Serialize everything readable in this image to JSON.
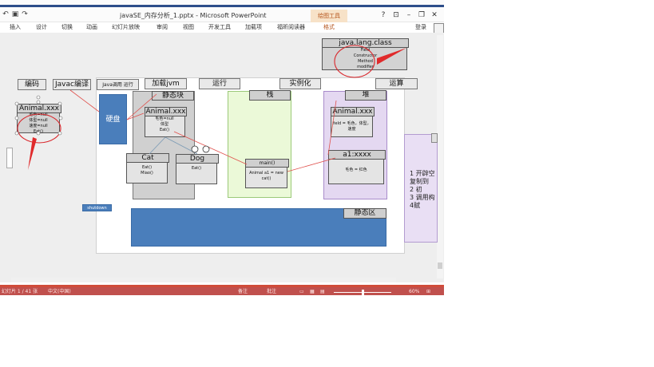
{
  "window": {
    "title": "javaSE_内存分析_1.pptx - Microsoft PowerPoint",
    "contextual_tab": "绘图工具",
    "controls": {
      "help": "?",
      "ribbon_options": "⊡",
      "minimize": "–",
      "restore": "❐",
      "close": "✕"
    }
  },
  "quick_access": {
    "undo_icon": "↶",
    "save_icon": "▣",
    "redo_icon": "↷"
  },
  "ribbon": {
    "tabs": [
      "插入",
      "设计",
      "切换",
      "动画",
      "幻灯片放映",
      "审阅",
      "视图",
      "开发工具",
      "加载项",
      "福昕阅读器",
      "格式"
    ],
    "login": "登录"
  },
  "diagram": {
    "top_class": {
      "title": "java.lang.class",
      "body": "Field\nConstructor\nMethod\nmodifier"
    },
    "flow": [
      "编码",
      "Javac编译",
      "Java调用 运行",
      "加载jvm",
      "运行",
      "实例化",
      "运算"
    ],
    "left_class": {
      "title": "Animal.xxx",
      "body": "毛色=null\n体型=null\n速度=null\nEat()"
    },
    "disk_label": "硬盘",
    "static_block": {
      "title": "静态块"
    },
    "animal_xxx": {
      "title": "Animal.xxx",
      "body": "毛色=null\n体型\nEat()"
    },
    "cat": {
      "title": "Cat",
      "body": "Eat()\nMiao()"
    },
    "dog": {
      "title": "Dog",
      "body": "Eat()"
    },
    "stack": {
      "title": "栈",
      "main_title": "main()",
      "main_body": "Animal a1 = new\ncat()"
    },
    "heap": {
      "title": "堆",
      "animal_box": {
        "title": "Animal.xxx",
        "body": "field = 毛色，体型，\n速度"
      },
      "a1_box": {
        "title": "a1:xxxx",
        "body": "毛色 = 红色"
      }
    },
    "shutdown_button": "shutdown",
    "static_area": "静态区",
    "notes": "1 开辟空\n复制到\n2 初\n3 调用构\n4赋"
  },
  "status": {
    "slide_info": "幻灯片 1 / 41 张",
    "language": "中文(中国)",
    "notes": "备注",
    "comments": "批注",
    "zoom": "60%"
  },
  "colors": {
    "accent_red": "#c0504d",
    "shape_blue": "#4a7ebb",
    "stack_green": "#ebf9d8",
    "heap_purple": "#e4d8f1"
  }
}
